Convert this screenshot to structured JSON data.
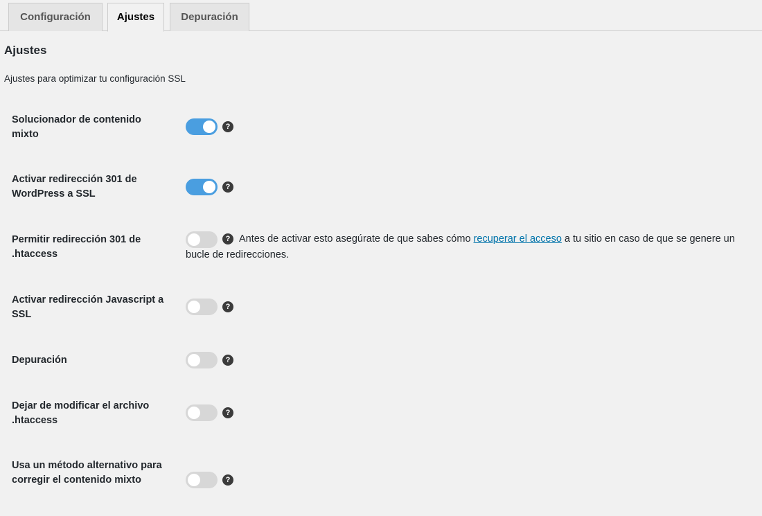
{
  "tabs": [
    {
      "label": "Configuración",
      "active": false
    },
    {
      "label": "Ajustes",
      "active": true
    },
    {
      "label": "Depuración",
      "active": false
    }
  ],
  "section": {
    "title": "Ajustes",
    "description": "Ajustes para optimizar tu configuración SSL"
  },
  "settings": [
    {
      "label": "Solucionador de contenido mixto",
      "enabled": true
    },
    {
      "label": "Activar redirección 301 de WordPress a SSL",
      "enabled": true
    },
    {
      "label": "Permitir redirección 301 de .htaccess",
      "enabled": false,
      "note_before": "Antes de activar esto asegúrate de que sabes cómo ",
      "note_link": "recuperar el acceso",
      "note_after": " a tu sitio en caso de que se genere un bucle de redirecciones."
    },
    {
      "label": "Activar redirección Javascript a SSL",
      "enabled": false
    },
    {
      "label": "Depuración",
      "enabled": false
    },
    {
      "label": "Dejar de modificar el archivo .htaccess",
      "enabled": false
    },
    {
      "label": "Usa un método alternativo para corregir el contenido mixto",
      "enabled": false
    }
  ],
  "help_icon_glyph": "?",
  "colors": {
    "toggle_on": "#4a9ee0",
    "toggle_off": "#d7d7d7",
    "link": "#0073aa"
  }
}
